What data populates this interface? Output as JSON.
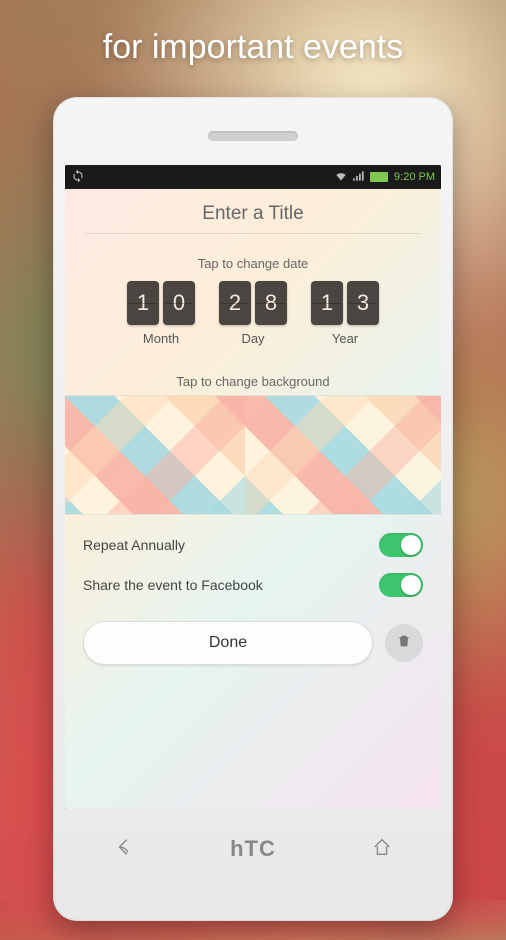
{
  "hero": {
    "text": "for important events"
  },
  "statusbar": {
    "time": "9:20 PM"
  },
  "app": {
    "title_placeholder": "Enter a Title",
    "date_label": "Tap to change date",
    "date": {
      "month": {
        "d1": "1",
        "d2": "0",
        "label": "Month"
      },
      "day": {
        "d1": "2",
        "d2": "8",
        "label": "Day"
      },
      "year": {
        "d1": "1",
        "d2": "3",
        "label": "Year"
      }
    },
    "bg_label": "Tap to change background",
    "options": {
      "repeat_label": "Repeat Annually",
      "share_label": "Share the event to Facebook"
    },
    "done_label": "Done"
  },
  "phone": {
    "brand": "hTC"
  }
}
